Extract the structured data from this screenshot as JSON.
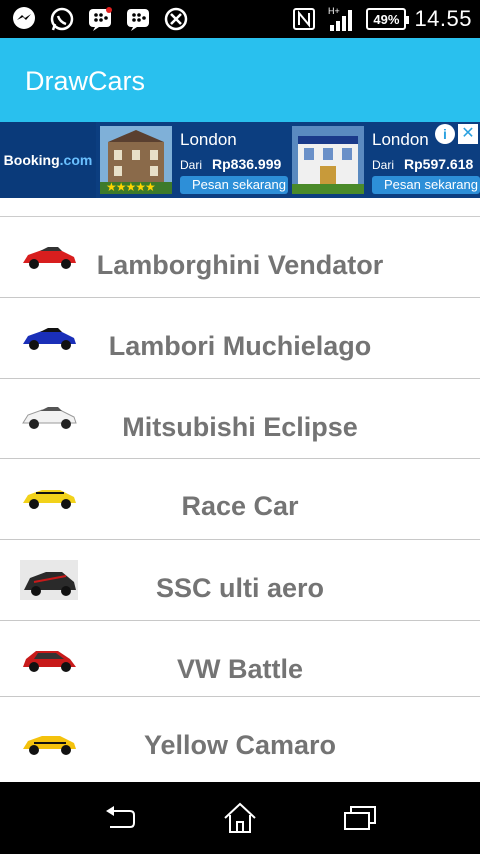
{
  "status_bar": {
    "icons_left": [
      "messenger-icon",
      "whatsapp-icon",
      "bbm-icon",
      "bbm-icon-2",
      "sync-icon"
    ],
    "network": "H+",
    "battery": "49%",
    "time": "14.55"
  },
  "app_bar": {
    "title": "DrawCars",
    "color": "#29c0ee"
  },
  "ad": {
    "brand_prefix": "Booking",
    "brand_suffix": ".com",
    "cards": [
      {
        "city": "London",
        "dari": "Dari",
        "price": "Rp836.999",
        "cta": "Pesan sekarang",
        "stars": "★★★★★"
      },
      {
        "city": "London",
        "dari": "Dari",
        "price": "Rp597.618",
        "cta": "Pesan sekarang"
      }
    ],
    "info_icon": "i",
    "close_icon": "✕"
  },
  "cars": [
    {
      "name": "Lamborghini Vendator",
      "color": "#d81e1e"
    },
    {
      "name": "Lambori Muchielago",
      "color": "#1a2fb8"
    },
    {
      "name": "Mitsubishi Eclipse",
      "color": "#f2f2f2"
    },
    {
      "name": "Race Car",
      "color": "#f2d21a"
    },
    {
      "name": "SSC ulti aero",
      "color": "#2a2a2a"
    },
    {
      "name": "VW Battle",
      "color": "#c81a1a"
    },
    {
      "name": "Yellow Camaro",
      "color": "#f4c20d"
    }
  ]
}
